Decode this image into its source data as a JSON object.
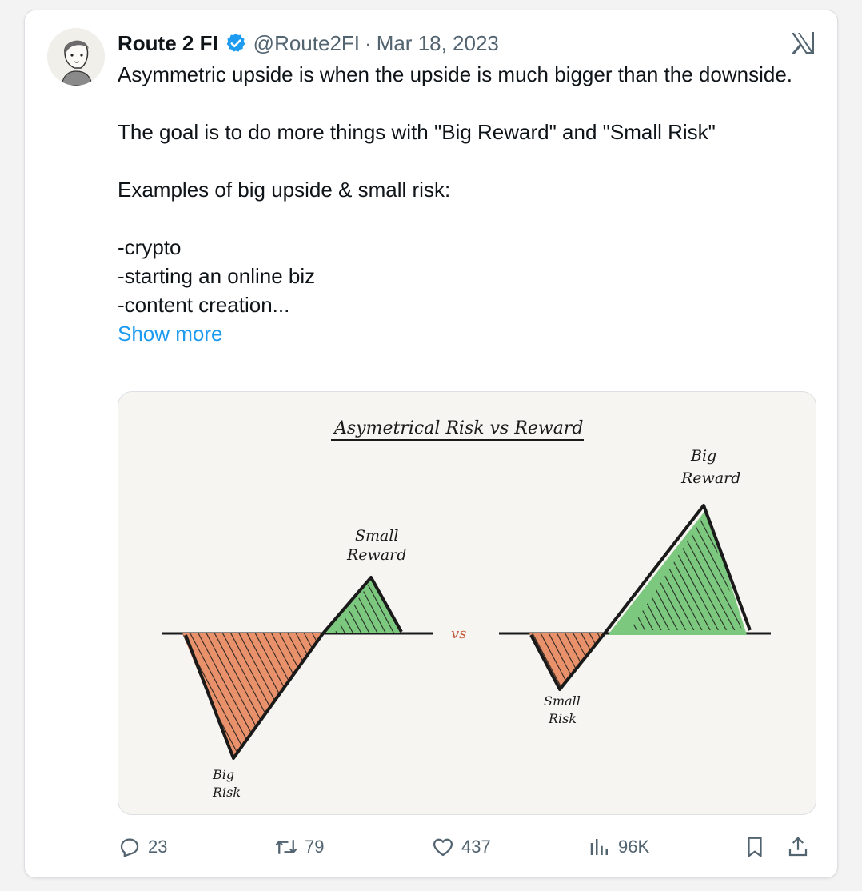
{
  "tweet": {
    "author_name": "Route 2 FI",
    "handle": "@Route2FI",
    "separator": "·",
    "date": "Mar 18, 2023",
    "lines": [
      "Asymmetric upside is when the upside is much bigger than the downside.",
      "",
      "The goal is to do more things with \"Big Reward\" and \"Small Risk\"",
      "",
      "Examples of big upside & small risk:",
      "",
      "-crypto",
      "-starting an online biz",
      "-content creation..."
    ],
    "show_more": "Show more"
  },
  "image": {
    "title": "Asymetrical Risk vs Reward",
    "vs": "vs",
    "left_reward_1": "Small",
    "left_reward_2": "Reward",
    "left_risk_1": "Big",
    "left_risk_2": "Risk",
    "right_reward_1": "Big",
    "right_reward_2": "Reward",
    "right_risk_1": "Small",
    "right_risk_2": "Risk"
  },
  "actions": {
    "replies": "23",
    "reposts": "79",
    "likes": "437",
    "views": "96K"
  },
  "colors": {
    "verified": "#1d9bf0",
    "link": "#1d9bf0",
    "risk_fill": "#e8916a",
    "reward_fill": "#7cc87e"
  },
  "icons": [
    "verified-badge-icon",
    "x-logo-icon",
    "reply-icon",
    "repost-icon",
    "like-icon",
    "views-icon",
    "bookmark-icon",
    "share-icon"
  ]
}
